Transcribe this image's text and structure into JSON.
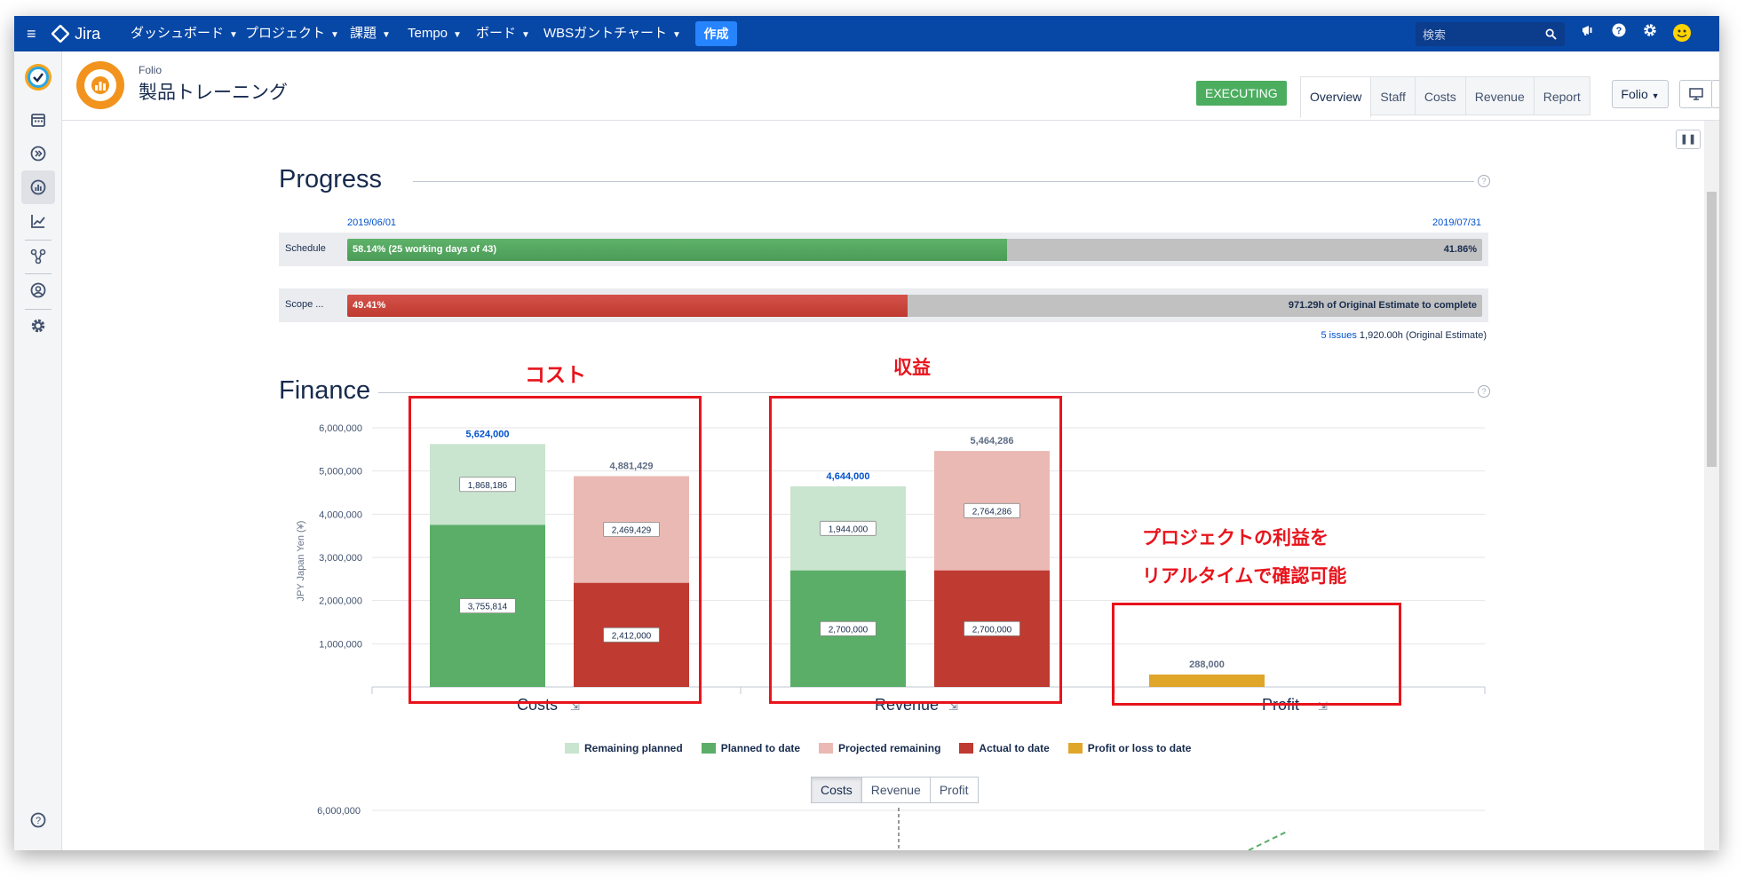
{
  "topbar": {
    "menu_icon": "hamburger-icon",
    "logo_text": "Jira",
    "nav": [
      {
        "label": "ダッシュボード"
      },
      {
        "label": "プロジェクト"
      },
      {
        "label": "課題"
      },
      {
        "label": "Tempo"
      },
      {
        "label": "ボード"
      },
      {
        "label": "WBSガントチャート"
      }
    ],
    "create_label": "作成",
    "search_placeholder": "検索"
  },
  "header": {
    "app_label": "Folio",
    "project_name": "製品トレーニング",
    "status": "EXECUTING",
    "tabs": [
      "Overview",
      "Staff",
      "Costs",
      "Revenue",
      "Report"
    ],
    "active_tab": "Overview",
    "folio_dropdown": "Folio"
  },
  "progress": {
    "title": "Progress",
    "start_date": "2019/06/01",
    "end_date": "2019/07/31",
    "schedule": {
      "label": "Schedule",
      "percent": 58.14,
      "fill_text": "58.14%   (25 working days of 43)",
      "remaining_text": "41.86%"
    },
    "scope": {
      "label": "Scope ...",
      "percent": 49.41,
      "fill_text": "49.41%",
      "remaining_text": "971.29h of Original Estimate to complete"
    },
    "issues_link": "5 issues",
    "issues_estimate": "1,920.00h (Original Estimate)"
  },
  "finance": {
    "title": "Finance",
    "chart_tabs": [
      "Costs",
      "Revenue",
      "Profit"
    ],
    "active_chart_tab": "Costs",
    "lower_chart_top_tick": "6,000,000"
  },
  "annotations": {
    "cost": "コスト",
    "revenue": "収益",
    "profit_line1": "プロジェクトの利益を",
    "profit_line2": "リアルタイムで確認可能"
  },
  "colors": {
    "remaining_planned": "#c9e4cf",
    "planned_to_date": "#5bae68",
    "projected_remaining": "#ebb9b4",
    "actual_to_date": "#bf3a30",
    "profit": "#e0a62a",
    "annotation": "#e8141c"
  },
  "chart_data": {
    "type": "bar",
    "stacked": true,
    "ylabel": "JPY Japan Yen (¥)",
    "ylim": [
      0,
      6000000
    ],
    "yticks": [
      "1,000,000",
      "2,000,000",
      "3,000,000",
      "4,000,000",
      "5,000,000",
      "6,000,000"
    ],
    "ytick_values": [
      1000000,
      2000000,
      3000000,
      4000000,
      5000000,
      6000000
    ],
    "categories": [
      "Costs",
      "Revenue",
      "Profit"
    ],
    "series": [
      {
        "name": "Remaining planned",
        "values": [
          1868186,
          1944000,
          null
        ]
      },
      {
        "name": "Planned to date",
        "values": [
          3755814,
          2700000,
          null
        ]
      },
      {
        "name": "Projected remaining",
        "values": [
          2469429,
          2764286,
          null
        ]
      },
      {
        "name": "Actual to date",
        "values": [
          2412000,
          2700000,
          null
        ]
      },
      {
        "name": "Profit or loss to date",
        "values": [
          null,
          null,
          288000
        ]
      }
    ],
    "totals": {
      "planned": [
        "5,624,000",
        "4,644,000"
      ],
      "projected": [
        "4,881,429",
        "5,464,286"
      ],
      "profit": "288,000"
    },
    "segment_labels": {
      "remaining_planned": [
        "1,868,186",
        "1,944,000"
      ],
      "planned_to_date": [
        "3,755,814",
        "2,700,000"
      ],
      "projected_remaining": [
        "2,469,429",
        "2,764,286"
      ],
      "actual_to_date": [
        "2,412,000",
        "2,700,000"
      ]
    },
    "legend_position": "bottom"
  }
}
